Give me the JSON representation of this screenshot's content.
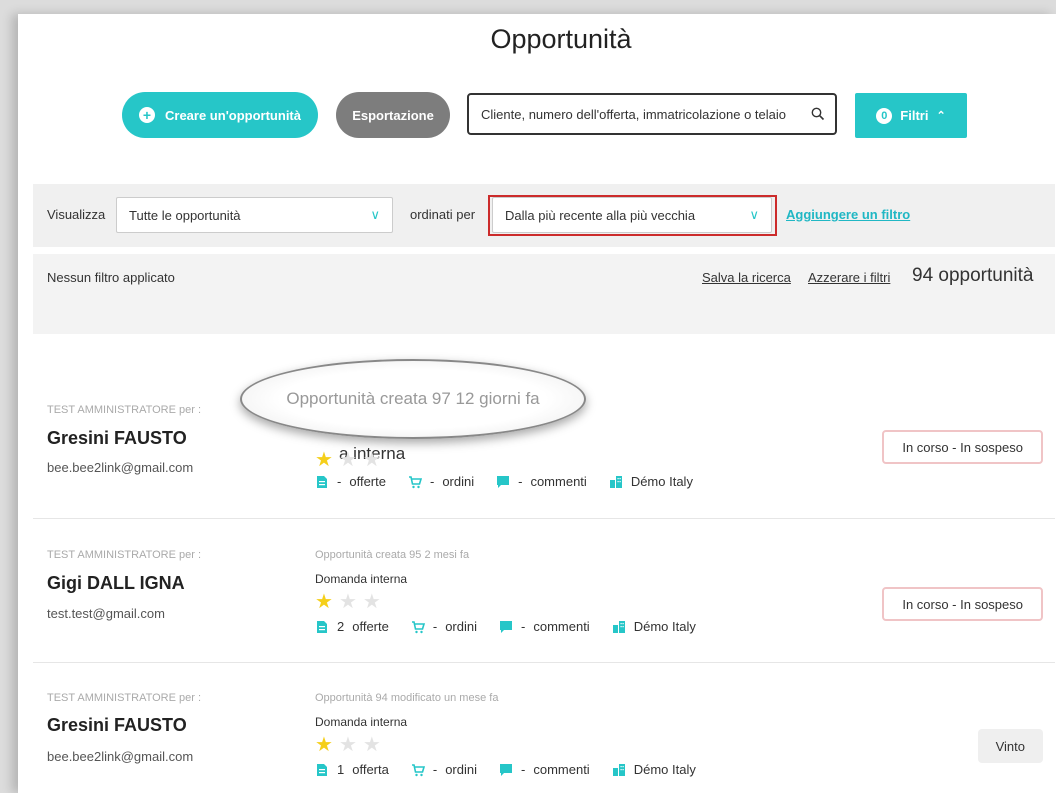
{
  "page_title": "Opportunità",
  "toolbar": {
    "create_label": "Creare un'opportunità",
    "export_label": "Esportazione",
    "search_placeholder": "Cliente, numero dell'offerta, immatricolazione o telaio",
    "filters_count": "0",
    "filters_label": "Filtri"
  },
  "filter_bar": {
    "show_label": "Visualizza",
    "show_value": "Tutte le opportunità",
    "sort_label": "ordinati per",
    "sort_value": "Dalla più recente alla più vecchia",
    "add_filter_label": "Aggiungere un filtro"
  },
  "status_bar": {
    "no_filter_text": "Nessun filtro applicato",
    "save_search": "Salva la ricerca",
    "reset_filters": "Azzerare i filtri",
    "count_text": "94 opportunità"
  },
  "rows": [
    {
      "who": "TEST AMMINISTRATORE per :",
      "name": "Gresini FAUSTO",
      "email": "bee.bee2link@gmail.com",
      "created": "",
      "type": "",
      "rating": 1,
      "offers_num": "-",
      "offers_label": "offerte",
      "orders_num": "-",
      "orders_label": "ordini",
      "comments_num": "-",
      "comments_label": "commenti",
      "site": "Démo Italy",
      "status": "In corso - In sospeso"
    },
    {
      "who": "TEST AMMINISTRATORE per :",
      "name": "Gigi DALL IGNA",
      "email": "test.test@gmail.com",
      "created": "Opportunità creata 95 2 mesi fa",
      "type": "Domanda interna",
      "rating": 1,
      "offers_num": "2",
      "offers_label": "offerte",
      "orders_num": "-",
      "orders_label": "ordini",
      "comments_num": "-",
      "comments_label": "commenti",
      "site": "Démo Italy",
      "status": "In corso - In sospeso"
    },
    {
      "who": "TEST AMMINISTRATORE per :",
      "name": "Gresini FAUSTO",
      "email": "bee.bee2link@gmail.com",
      "created": "Opportunità 94 modificato un mese fa",
      "type": "Domanda interna",
      "rating": 1,
      "offers_num": "1",
      "offers_label": "offerta",
      "orders_num": "-",
      "orders_label": "ordini",
      "comments_num": "-",
      "comments_label": "commenti",
      "site": "Démo Italy",
      "status": "Vinto"
    }
  ],
  "magnifier": {
    "text": "Opportunità creata 97 12 giorni fa",
    "peek_text": "a interna"
  },
  "colors": {
    "accent": "#26c6c8",
    "star": "#f5cf1a",
    "highlight": "#cc2b2b"
  }
}
